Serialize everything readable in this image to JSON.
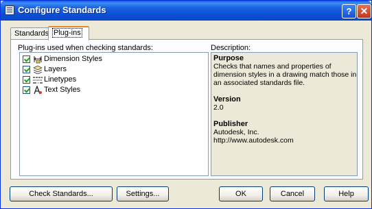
{
  "window": {
    "title": "Configure Standards",
    "help_glyph": "?",
    "close_glyph": "✕"
  },
  "tabs": [
    {
      "label": "Standards",
      "active": false
    },
    {
      "label": "Plug-ins",
      "active": true
    }
  ],
  "plugins": {
    "label": "Plug-ins used when checking standards:",
    "items": [
      {
        "label": "Dimension Styles",
        "checked": true,
        "icon": "dimension-styles-icon"
      },
      {
        "label": "Layers",
        "checked": true,
        "icon": "layers-icon"
      },
      {
        "label": "Linetypes",
        "checked": true,
        "icon": "linetypes-icon"
      },
      {
        "label": "Text Styles",
        "checked": true,
        "icon": "text-styles-icon"
      }
    ]
  },
  "description": {
    "label": "Description:",
    "purpose_heading": "Purpose",
    "purpose_text": "Checks that names and properties of dimension styles in a drawing match those in an associated standards file.",
    "version_heading": "Version",
    "version_text": "2.0",
    "publisher_heading": "Publisher",
    "publisher_name": "Autodesk, Inc.",
    "publisher_url": "http://www.autodesk.com"
  },
  "buttons": {
    "check_standards": "Check Standards...",
    "settings": "Settings...",
    "ok": "OK",
    "cancel": "Cancel",
    "help": "Help"
  }
}
